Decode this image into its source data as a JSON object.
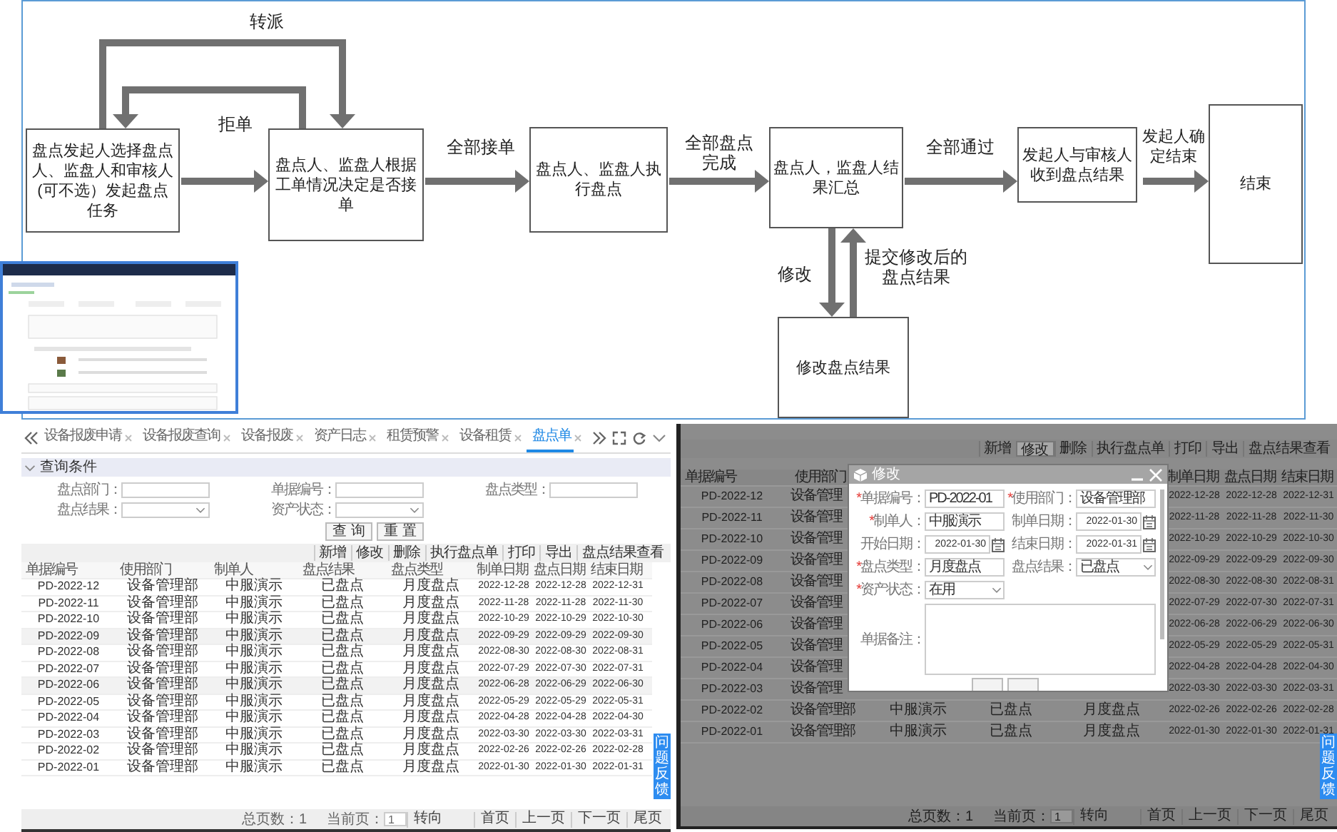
{
  "flowchart": {
    "nodes": [
      {
        "text": "盘点发起人选择盘点人、监盘人和审核人(可不选）发起盘点任务"
      },
      {
        "text": "盘点人、监盘人根据工单情况决定是否接单"
      },
      {
        "text": "盘点人、监盘人执行盘点"
      },
      {
        "text": "盘点人，监盘人结果汇总"
      },
      {
        "text": "发起人与审核人收到盘点结果"
      },
      {
        "text": "结束"
      },
      {
        "text": "修改盘点结果"
      }
    ],
    "labels": [
      {
        "text": "转派"
      },
      {
        "text": "拒单"
      },
      {
        "text": "全部接单"
      },
      {
        "text": "全部盘点完成"
      },
      {
        "text": "全部通过"
      },
      {
        "text": "发起人确定结束"
      },
      {
        "text": "修改"
      },
      {
        "text": "提交修改后的盘点结果"
      }
    ]
  },
  "list_screen": {
    "tabs": [
      {
        "label": "设备报废申请",
        "selected": false
      },
      {
        "label": "设备报废查询",
        "selected": false
      },
      {
        "label": "设备报废",
        "selected": false
      },
      {
        "label": "资产日志",
        "selected": false
      },
      {
        "label": "租赁预警",
        "selected": false
      },
      {
        "label": "设备租赁",
        "selected": false
      },
      {
        "label": "盘点单",
        "selected": true
      }
    ],
    "query": {
      "title": "查询条件",
      "fields": [
        {
          "label": "盘点部门：",
          "kind": "text"
        },
        {
          "label": "单据编号：",
          "kind": "text"
        },
        {
          "label": "盘点类型：",
          "kind": "text"
        },
        {
          "label": "盘点结果：",
          "kind": "select"
        },
        {
          "label": "资产状态：",
          "kind": "select"
        }
      ],
      "buttons": [
        "查 询",
        "重 置"
      ]
    },
    "toolbar": [
      "新增",
      "修改",
      "删除",
      "执行盘点单",
      "打印",
      "导出",
      "盘点结果查看"
    ],
    "table": {
      "columns": {
        "number": "单据编号",
        "department": "使用部门",
        "maker": "制单人",
        "result": "盘点结果",
        "type": "盘点类型",
        "made": "制单日期",
        "counted": "盘点日期",
        "ended": "结束日期"
      },
      "rows": [
        {
          "shaded": false,
          "number": "PD-2022-12",
          "department": "设备管理部",
          "maker": "中服演示",
          "result": "已盘点",
          "type": "月度盘点",
          "made": "2022-12-28",
          "counted": "2022-12-28",
          "ended": "2022-12-31"
        },
        {
          "shaded": false,
          "number": "PD-2022-11",
          "department": "设备管理部",
          "maker": "中服演示",
          "result": "已盘点",
          "type": "月度盘点",
          "made": "2022-11-28",
          "counted": "2022-11-28",
          "ended": "2022-11-30"
        },
        {
          "shaded": false,
          "number": "PD-2022-10",
          "department": "设备管理部",
          "maker": "中服演示",
          "result": "已盘点",
          "type": "月度盘点",
          "made": "2022-10-29",
          "counted": "2022-10-29",
          "ended": "2022-10-30"
        },
        {
          "shaded": true,
          "number": "PD-2022-09",
          "department": "设备管理部",
          "maker": "中服演示",
          "result": "已盘点",
          "type": "月度盘点",
          "made": "2022-09-29",
          "counted": "2022-09-29",
          "ended": "2022-09-30"
        },
        {
          "shaded": false,
          "number": "PD-2022-08",
          "department": "设备管理部",
          "maker": "中服演示",
          "result": "已盘点",
          "type": "月度盘点",
          "made": "2022-08-30",
          "counted": "2022-08-30",
          "ended": "2022-08-31"
        },
        {
          "shaded": false,
          "number": "PD-2022-07",
          "department": "设备管理部",
          "maker": "中服演示",
          "result": "已盘点",
          "type": "月度盘点",
          "made": "2022-07-29",
          "counted": "2022-07-30",
          "ended": "2022-07-31"
        },
        {
          "shaded": true,
          "number": "PD-2022-06",
          "department": "设备管理部",
          "maker": "中服演示",
          "result": "已盘点",
          "type": "月度盘点",
          "made": "2022-06-28",
          "counted": "2022-06-29",
          "ended": "2022-06-30"
        },
        {
          "shaded": false,
          "number": "PD-2022-05",
          "department": "设备管理部",
          "maker": "中服演示",
          "result": "已盘点",
          "type": "月度盘点",
          "made": "2022-05-29",
          "counted": "2022-05-29",
          "ended": "2022-05-31"
        },
        {
          "shaded": false,
          "number": "PD-2022-04",
          "department": "设备管理部",
          "maker": "中服演示",
          "result": "已盘点",
          "type": "月度盘点",
          "made": "2022-04-28",
          "counted": "2022-04-28",
          "ended": "2022-04-30"
        },
        {
          "shaded": false,
          "number": "PD-2022-03",
          "department": "设备管理部",
          "maker": "中服演示",
          "result": "已盘点",
          "type": "月度盘点",
          "made": "2022-03-30",
          "counted": "2022-03-30",
          "ended": "2022-03-31"
        },
        {
          "shaded": false,
          "number": "PD-2022-02",
          "department": "设备管理部",
          "maker": "中服演示",
          "result": "已盘点",
          "type": "月度盘点",
          "made": "2022-02-26",
          "counted": "2022-02-26",
          "ended": "2022-02-28"
        },
        {
          "shaded": false,
          "number": "PD-2022-01",
          "department": "设备管理部",
          "maker": "中服演示",
          "result": "已盘点",
          "type": "月度盘点",
          "made": "2022-01-30",
          "counted": "2022-01-30",
          "ended": "2022-01-31"
        }
      ]
    },
    "footer": {
      "total": "总页数：1",
      "page_label": "当前页：",
      "page": "1",
      "go": "转向",
      "nav": [
        "首页",
        "上一页",
        "下一页",
        "尾页"
      ]
    },
    "feedback": "问题反馈"
  },
  "edit_screen": {
    "toolbar": [
      {
        "label": "新增",
        "pressed": false
      },
      {
        "label": "修改",
        "pressed": true
      },
      {
        "label": "删除",
        "pressed": false
      },
      {
        "label": "执行盘点单",
        "pressed": false
      },
      {
        "label": "打印",
        "pressed": false
      },
      {
        "label": "导出",
        "pressed": false
      },
      {
        "label": "盘点结果查看",
        "pressed": false
      }
    ],
    "table": {
      "columns": {
        "number": "单据编号",
        "department": "使用部门",
        "made": "制单日期",
        "counted": "盘点日期",
        "ended": "结束日期"
      },
      "rows": [
        {
          "number": "PD-2022-12",
          "department": "设备管理",
          "made": "2022-12-28",
          "counted": "2022-12-28",
          "ended": "2022-12-31"
        },
        {
          "number": "PD-2022-11",
          "department": "设备管理",
          "made": "2022-11-28",
          "counted": "2022-11-28",
          "ended": "2022-11-30"
        },
        {
          "number": "PD-2022-10",
          "department": "设备管理",
          "made": "2022-10-29",
          "counted": "2022-10-29",
          "ended": "2022-10-30"
        },
        {
          "number": "PD-2022-09",
          "department": "设备管理",
          "made": "2022-09-29",
          "counted": "2022-09-29",
          "ended": "2022-09-30"
        },
        {
          "number": "PD-2022-08",
          "department": "设备管理",
          "made": "2022-08-30",
          "counted": "2022-08-30",
          "ended": "2022-08-31"
        },
        {
          "number": "PD-2022-07",
          "department": "设备管理",
          "made": "2022-07-29",
          "counted": "2022-07-30",
          "ended": "2022-07-31"
        },
        {
          "number": "PD-2022-06",
          "department": "设备管理",
          "made": "2022-06-28",
          "counted": "2022-06-29",
          "ended": "2022-06-30"
        },
        {
          "number": "PD-2022-05",
          "department": "设备管理",
          "made": "2022-05-29",
          "counted": "2022-05-29",
          "ended": "2022-05-31"
        },
        {
          "number": "PD-2022-04",
          "department": "设备管理",
          "made": "2022-04-28",
          "counted": "2022-04-28",
          "ended": "2022-04-30"
        },
        {
          "number": "PD-2022-03",
          "department": "设备管理",
          "made": "2022-03-30",
          "counted": "2022-03-30",
          "ended": "2022-03-31"
        },
        {
          "number": "PD-2022-02",
          "department": "设备管理部",
          "maker": "中服演示",
          "result": "已盘点",
          "type": "月度盘点",
          "made": "2022-02-26",
          "counted": "2022-02-26",
          "ended": "2022-02-28"
        },
        {
          "number": "PD-2022-01",
          "department": "设备管理部",
          "maker": "中服演示",
          "result": "已盘点",
          "type": "月度盘点",
          "made": "2022-01-30",
          "counted": "2022-01-30",
          "ended": "2022-01-31"
        }
      ]
    },
    "dialog": {
      "title": "修改",
      "fields": [
        {
          "mark": "*",
          "label": "单据编号：",
          "value": "PD-2022-01",
          "kind": "text"
        },
        {
          "mark": "*",
          "label": "使用部门：",
          "value": "设备管理部",
          "kind": "text"
        },
        {
          "mark": "*",
          "label": "制单人：",
          "value": "中服演示",
          "kind": "text"
        },
        {
          "label": "制单日期：",
          "value": "2022-01-30",
          "kind": "date"
        },
        {
          "label": "开始日期：",
          "value": "2022-01-30",
          "kind": "date"
        },
        {
          "label": "结束日期：",
          "value": "2022-01-31",
          "kind": "date"
        },
        {
          "mark": "*",
          "label": "盘点类型：",
          "value": "月度盘点",
          "kind": "text"
        },
        {
          "label": "盘点结果：",
          "value": "已盘点",
          "kind": "select"
        },
        {
          "mark": "*",
          "label": "资产状态：",
          "value": "在用",
          "kind": "select"
        },
        {
          "label": "单据备注：",
          "kind": "textarea"
        }
      ]
    },
    "footer": {
      "total": "总页数：1",
      "page_label": "当前页：",
      "page": "1",
      "go": "转向",
      "nav": [
        "首页",
        "上一页",
        "下一页",
        "尾页"
      ]
    },
    "feedback": "问题反馈"
  }
}
